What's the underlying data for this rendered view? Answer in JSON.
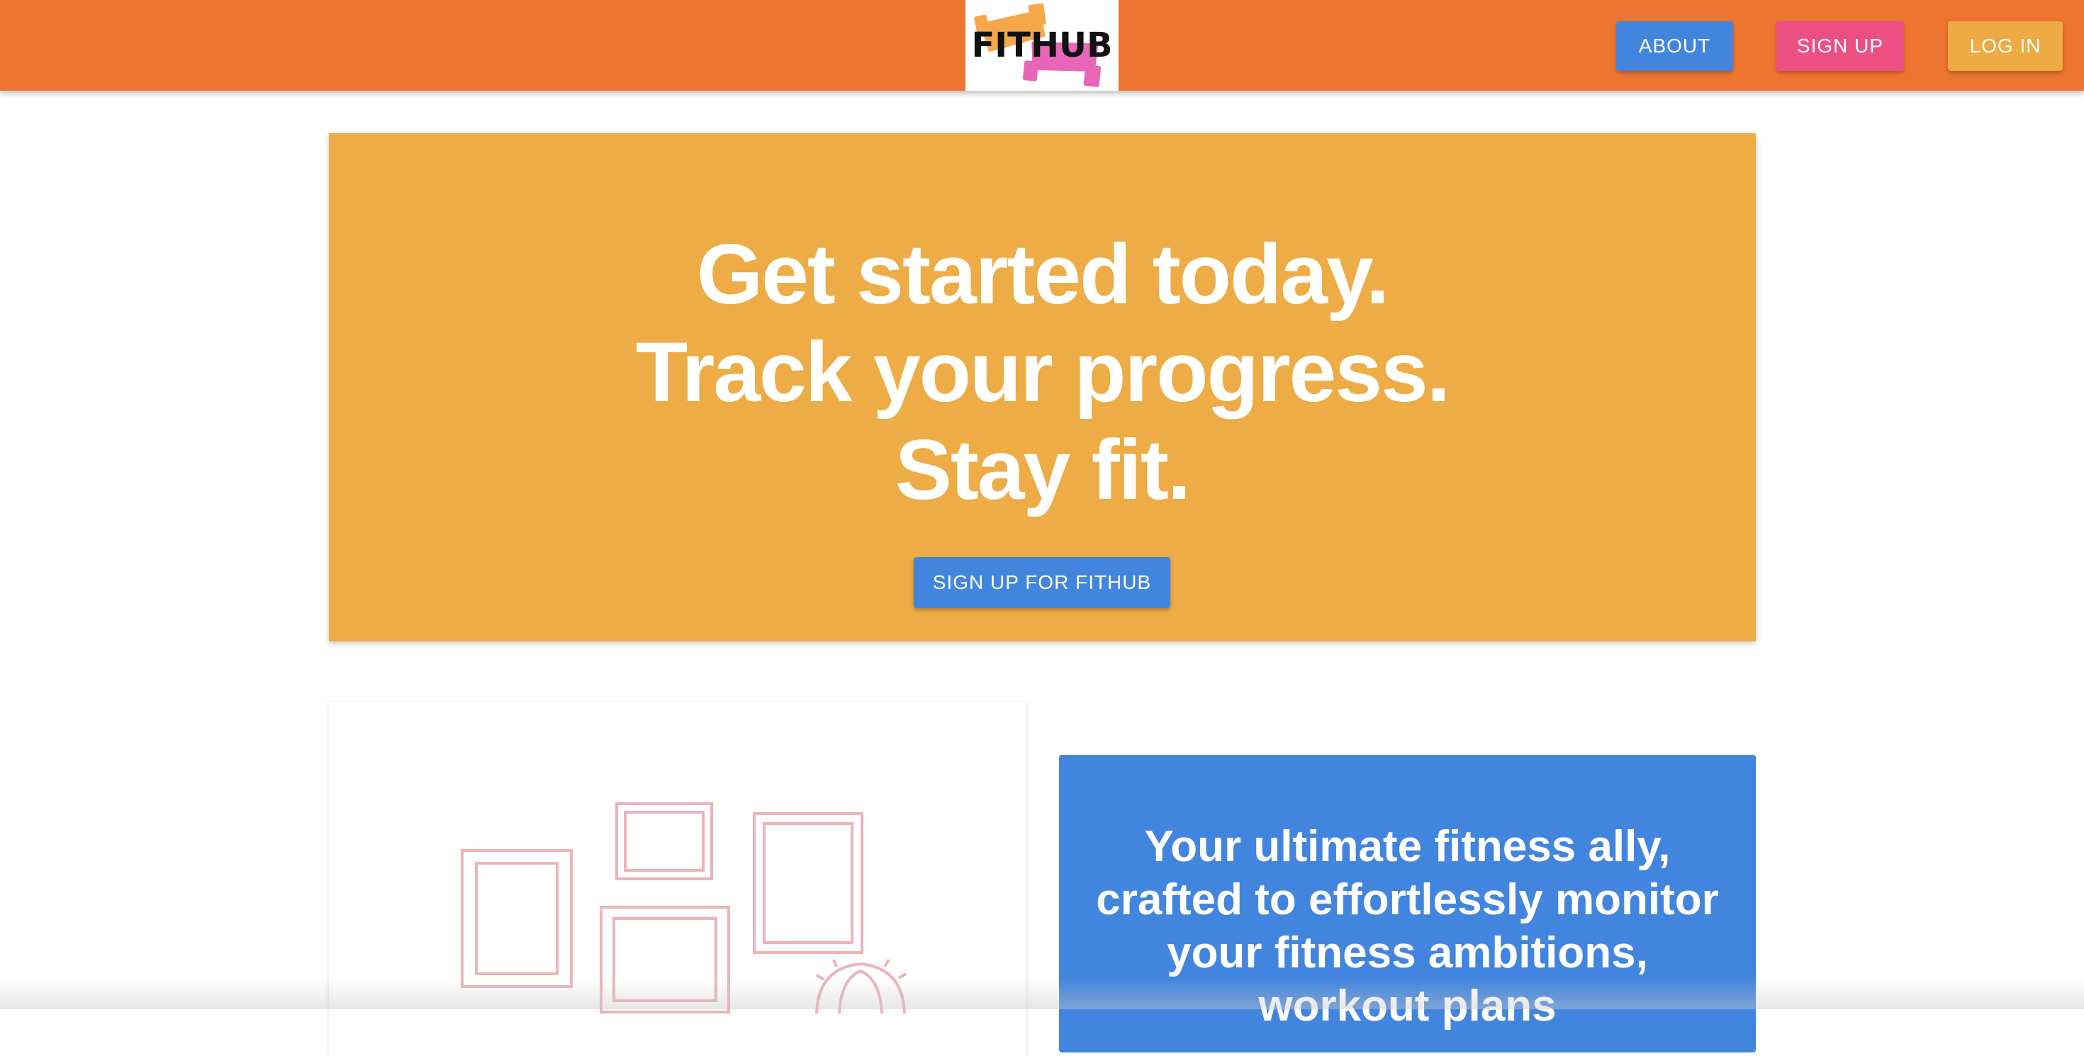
{
  "brand": {
    "logo_text": "FITHUB"
  },
  "nav": {
    "about_label": "ABOUT",
    "signup_label": "SIGN UP",
    "login_label": "LOG IN"
  },
  "hero": {
    "lines": [
      "Get started today.",
      "Track your progress.",
      "Stay fit."
    ],
    "cta_label": "SIGN UP FOR FITHUB"
  },
  "info": {
    "text": "Your ultimate fitness ally, crafted to effortlessly monitor your fitness ambitions, workout plans"
  },
  "colors": {
    "navbar": "#ED752F",
    "hero": "#EDAC45",
    "blue": "#4285DE",
    "pink": "#EC4F82",
    "orange": "#EEAA43"
  }
}
